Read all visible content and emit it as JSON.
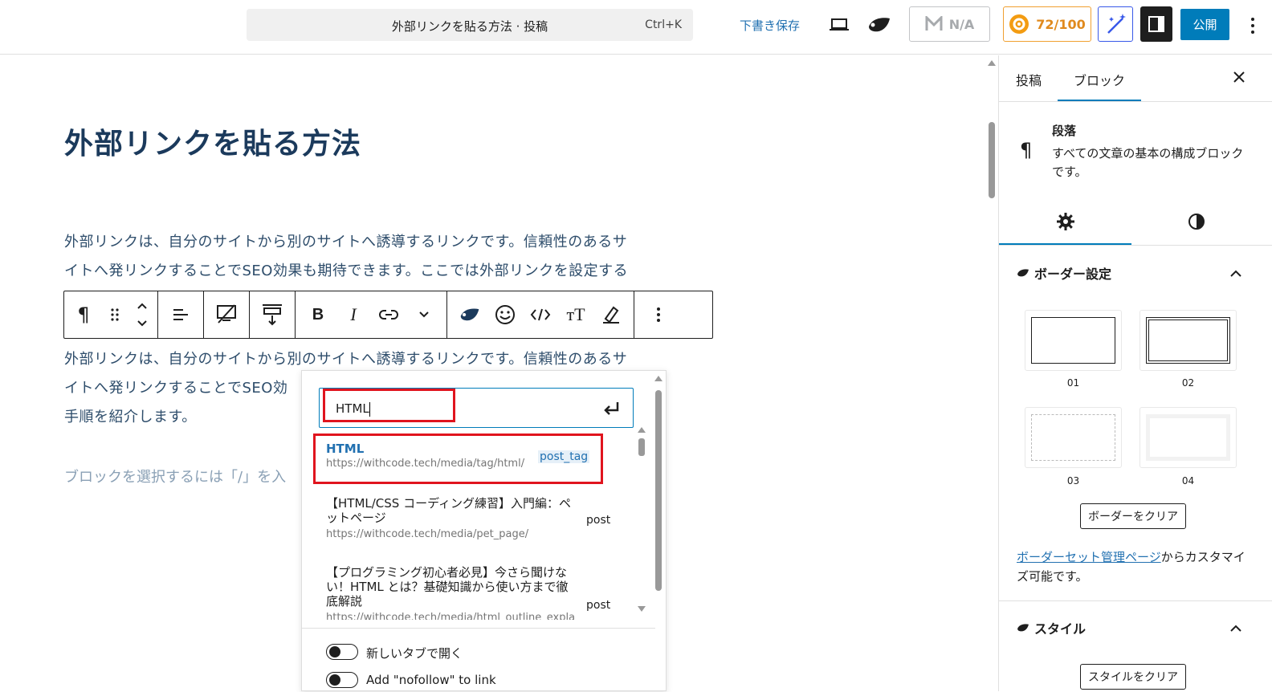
{
  "topbar": {
    "command_title": "外部リンクを貼る方法 · 投稿",
    "command_shortcut": "Ctrl+K",
    "draft_label": "下書き保存",
    "na_label": "N/A",
    "score_label": "72/100",
    "publish_label": "公開"
  },
  "editor": {
    "title": "外部リンクを貼る方法",
    "para1_line1": "外部リンクは、自分のサイトから別のサイトへ誘導するリンクです。信頼性のあるサ",
    "para1_line2": "イトへ発リンクすることでSEO効果も期待できます。ここでは外部リンクを設定する",
    "para2_line1": "外部リンクは、自分のサイトから別のサイトへ誘導するリンクです。信頼性のあるサ",
    "para2_line2": "イトへ発リンクすることでSEO効",
    "para2_line3": "手順を紹介します。",
    "placeholder": "ブロックを選択するには「/」を入"
  },
  "link_popover": {
    "input_value": "HTML",
    "results": [
      {
        "title": "HTML",
        "url": "https://withcode.tech/media/tag/html/",
        "type": "post_tag"
      },
      {
        "title": "【HTML/CSS コーディング練習】入門編：ペットページ",
        "url": "https://withcode.tech/media/pet_page/",
        "type": "post"
      },
      {
        "title": "【プログラミング初心者必見】今さら聞けない！HTML とは？基礎知識から使い方まで徹底解説",
        "url": "https://withcode.tech/media/html_outline_expla",
        "type": "post"
      }
    ],
    "toggle_new_tab": "新しいタブで開く",
    "toggle_nofollow": "Add \"nofollow\" to link"
  },
  "sidebar": {
    "tab_post": "投稿",
    "tab_block": "ブロック",
    "block_name": "段落",
    "block_desc": "すべての文章の基本の構成ブロックです。",
    "border_section": "ボーダー設定",
    "border_swatches": [
      "01",
      "02",
      "03",
      "04"
    ],
    "border_clear": "ボーダーをクリア",
    "note_link": "ボーダーセット管理ページ",
    "note_rest": "からカスタマイズ可能です。",
    "style_section": "スタイル",
    "style_clear": "スタイルをクリア"
  },
  "colors": {
    "accent": "#007cba",
    "title": "#1b3a5c",
    "highlight": "#e0141e"
  }
}
